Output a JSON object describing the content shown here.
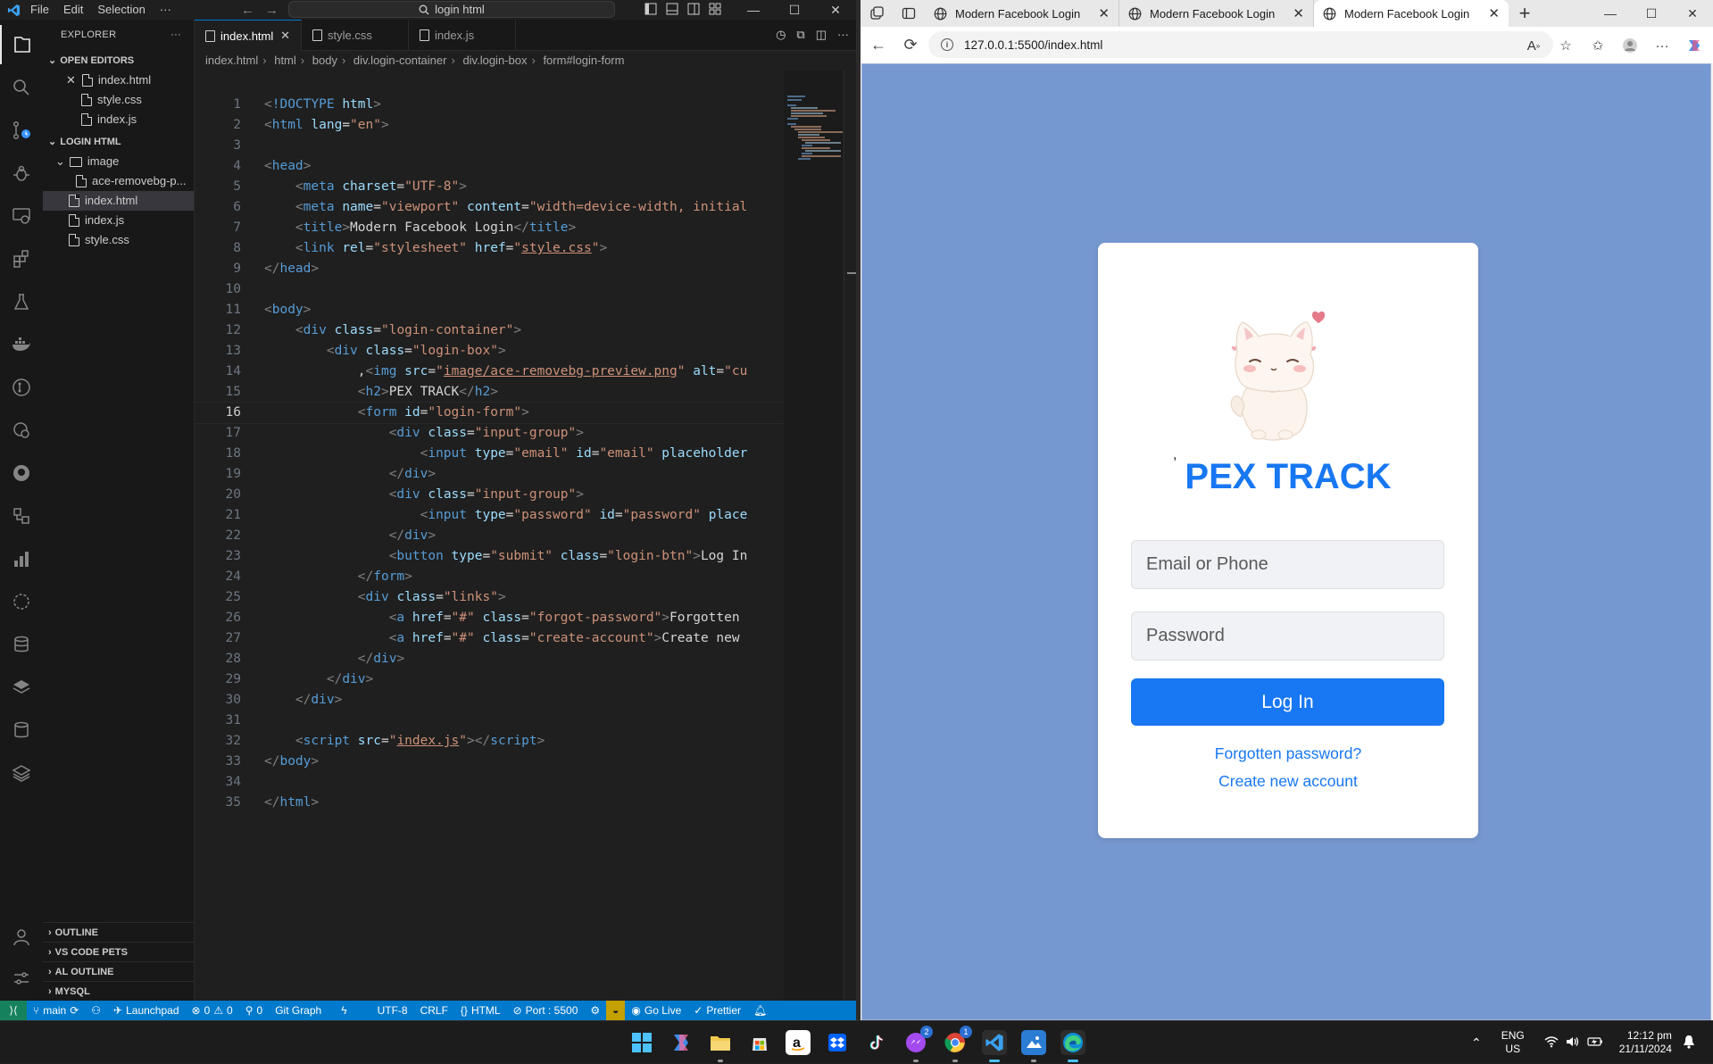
{
  "vscode": {
    "menu": [
      "File",
      "Edit",
      "Selection",
      "···"
    ],
    "command_center": "login html",
    "explorer": {
      "title": "EXPLORER",
      "open_editors_title": "OPEN EDITORS",
      "open_editors": [
        "index.html",
        "style.css",
        "index.js"
      ],
      "folder_title": "LOGIN HTML",
      "tree": [
        {
          "label": "image",
          "type": "folder"
        },
        {
          "label": "ace-removebg-p...",
          "type": "file"
        },
        {
          "label": "index.html",
          "type": "file"
        },
        {
          "label": "index.js",
          "type": "file"
        },
        {
          "label": "style.css",
          "type": "file"
        }
      ],
      "bottom_sections": [
        "OUTLINE",
        "VS CODE PETS",
        "AL OUTLINE",
        "MYSQL"
      ]
    },
    "tabs": [
      "index.html",
      "style.css",
      "index.js"
    ],
    "breadcrumb": [
      "index.html",
      "html",
      "body",
      "div.login-container",
      "div.login-box",
      "form#login-form"
    ],
    "current_line": 16,
    "status": {
      "branch": "main",
      "launchpad": "Launchpad",
      "errors": "0",
      "warnings": "0",
      "ports": "0",
      "git_graph": "Git Graph",
      "encoding": "UTF-8",
      "eol": "CRLF",
      "language": "HTML",
      "port": "Port : 5500",
      "go_live": "Go Live",
      "prettier": "Prettier"
    }
  },
  "browser": {
    "tabs": [
      "Modern Facebook Login",
      "Modern Facebook Login",
      "Modern Facebook Login"
    ],
    "active_tab": 2,
    "url": "127.0.0.1:5500/index.html",
    "page": {
      "stray_char": ",",
      "title": "PEX TRACK",
      "email_placeholder": "Email or Phone",
      "password_placeholder": "Password",
      "login_label": "Log In",
      "forgot_label": "Forgotten password?",
      "create_label": "Create new account"
    }
  },
  "taskbar": {
    "messenger_badge": "2",
    "chrome_badge": "1",
    "lang_line1": "ENG",
    "lang_line2": "US",
    "time": "12:12 pm",
    "date": "21/11/2024"
  }
}
